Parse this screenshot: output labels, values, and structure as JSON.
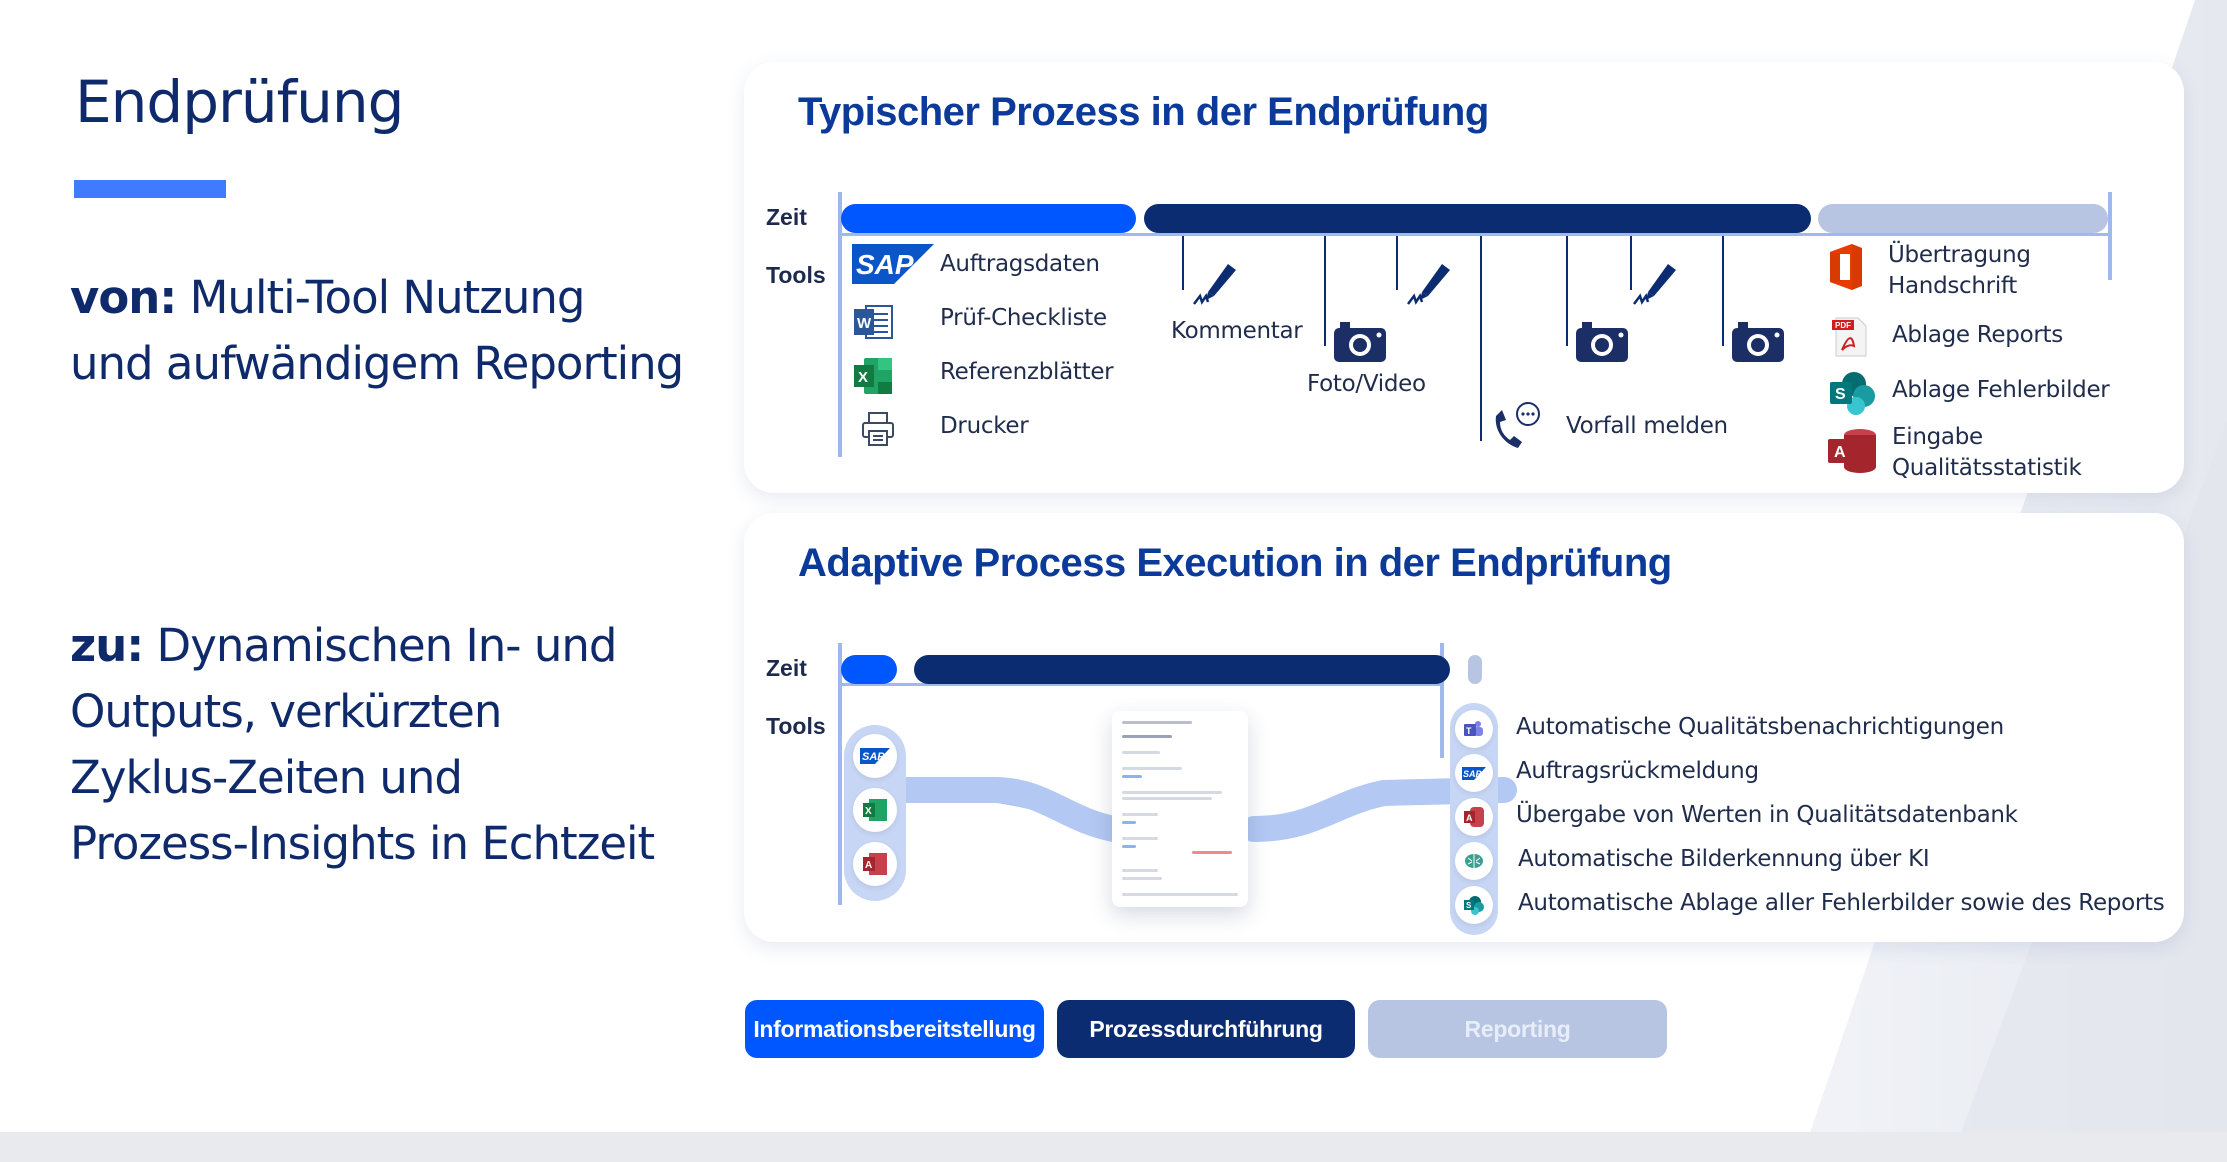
{
  "colors": {
    "brand_navy": "#0c2c72",
    "phase_info": "#0057ff",
    "phase_process": "#0c2c72",
    "phase_reporting": "#b7c5e3",
    "accent_bar": "#3f7bff",
    "title_blue": "#0b3a9a"
  },
  "left": {
    "title": "Endprüfung",
    "from": {
      "label": "von:",
      "lines": [
        "Multi-Tool Nutzung",
        "und aufwändigem Reporting"
      ]
    },
    "to": {
      "label": "zu:",
      "lines": [
        "Dynamischen In- und",
        "Outputs, verkürzten",
        "Zyklus-Zeiten und",
        "Prozess-Insights in Echtzeit"
      ]
    }
  },
  "card_typical": {
    "title": "Typischer Prozess in der Endprüfung",
    "row_time": "Zeit",
    "row_tools": "Tools",
    "timeline": [
      {
        "phase": "Informationsbereitstellung",
        "share": 0.23
      },
      {
        "phase": "Prozessdurchführung",
        "share": 0.52
      },
      {
        "phase": "Reporting",
        "share": 0.23
      }
    ],
    "info_tools": [
      {
        "icon": "sap-icon",
        "label": "Auftragsdaten"
      },
      {
        "icon": "word-icon",
        "label": "Prüf-Checkliste"
      },
      {
        "icon": "excel-icon",
        "label": "Referenzblätter"
      },
      {
        "icon": "printer-icon",
        "label": "Drucker"
      }
    ],
    "process_events": [
      {
        "icon": "signature-pen-icon",
        "label": "Kommentar"
      },
      {
        "icon": "camera-icon",
        "label": "Foto/Video"
      },
      {
        "icon": "signature-pen-icon",
        "label": ""
      },
      {
        "icon": "phone-chat-icon",
        "label": "Vorfall melden"
      },
      {
        "icon": "camera-icon",
        "label": ""
      },
      {
        "icon": "signature-pen-icon",
        "label": ""
      },
      {
        "icon": "camera-icon",
        "label": ""
      }
    ],
    "report_tools": [
      {
        "icon": "office-icon",
        "label_lines": [
          "Übertragung",
          "Handschrift"
        ]
      },
      {
        "icon": "pdf-icon",
        "label_lines": [
          "Ablage Reports"
        ]
      },
      {
        "icon": "sharepoint-icon",
        "label_lines": [
          "Ablage Fehlerbilder"
        ]
      },
      {
        "icon": "access-icon",
        "label_lines": [
          "Eingabe",
          "Qualitätsstatistik"
        ]
      }
    ]
  },
  "card_adaptive": {
    "title": "Adaptive Process Execution in der Endprüfung",
    "row_time": "Zeit",
    "row_tools": "Tools",
    "timeline": [
      {
        "phase": "Informationsbereitstellung",
        "share": 0.06
      },
      {
        "phase": "Prozessdurchführung",
        "share": 0.82
      },
      {
        "phase": "Reporting",
        "share": 0.02
      }
    ],
    "input_icons": [
      "sap-icon",
      "excel-icon",
      "access-icon"
    ],
    "outputs": [
      {
        "icon": "teams-icon",
        "label": "Automatische Qualitätsbenachrichtigungen"
      },
      {
        "icon": "sap-icon",
        "label": "Auftragsrückmeldung"
      },
      {
        "icon": "access-icon",
        "label": "Übergabe von Werten in Qualitätsdatenbank"
      },
      {
        "icon": "ai-brain-icon",
        "label": "Automatische Bilderkennung über KI"
      },
      {
        "icon": "sharepoint-icon",
        "label": "Automatische Ablage aller Fehlerbilder sowie des Reports"
      }
    ]
  },
  "legend": {
    "buttons": [
      {
        "label": "Informationsbereitstellung"
      },
      {
        "label": "Prozessdurchführung"
      },
      {
        "label": "Reporting"
      }
    ]
  }
}
